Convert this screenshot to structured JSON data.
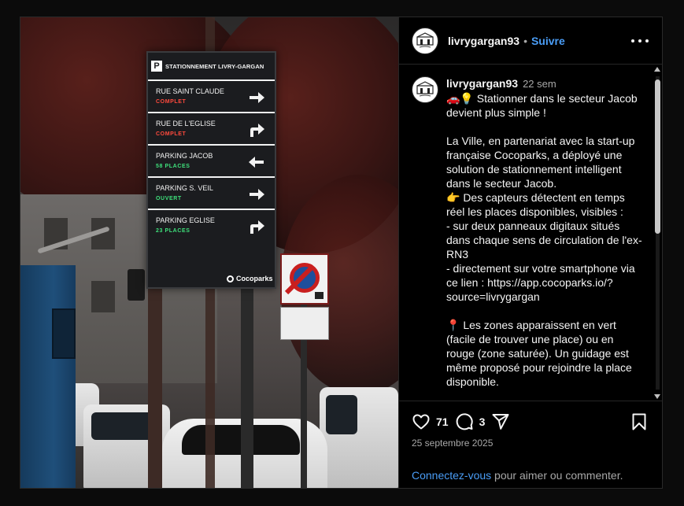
{
  "photo": {
    "sign": {
      "title": "STATIONNEMENT LIVRY-GARGAN",
      "p_letter": "P",
      "rows": [
        {
          "name": "RUE SAINT CLAUDE",
          "status": "COMPLET",
          "status_color": "#ff4a3d",
          "arrow": "right"
        },
        {
          "name": "RUE DE L'EGLISE",
          "status": "COMPLET",
          "status_color": "#ff4a3d",
          "arrow": "up-right"
        },
        {
          "name": "PARKING JACOB",
          "status": "58 PLACES",
          "status_color": "#3ee07b",
          "arrow": "left"
        },
        {
          "name": "PARKING S. VEIL",
          "status": "OUVERT",
          "status_color": "#3ee07b",
          "arrow": "right"
        },
        {
          "name": "PARKING EGLISE",
          "status": "23 PLACES",
          "status_color": "#3ee07b",
          "arrow": "up-right"
        }
      ],
      "brand": "Cocoparks"
    }
  },
  "header": {
    "username": "livrygargan93",
    "separator": "•",
    "follow_label": "Suivre",
    "more_icon": "more-horizontal-icon"
  },
  "post": {
    "username": "livrygargan93",
    "time": "22 sem",
    "caption": "🚗💡 Stationner dans le secteur Jacob devient plus simple !\n\nLa Ville, en partenariat avec la start-up française Cocoparks, a déployé une solution de stationnement intelligent dans le secteur Jacob.\n👉 Des capteurs détectent en temps réel les places disponibles, visibles :\n- sur deux panneaux digitaux situés dans chaque sens de circulation de l'ex-RN3\n- directement sur votre smartphone via ce lien : https://app.cocoparks.io/?source=livrygargan\n\n📍 Les zones apparaissent en vert (facile de trouver une place) ou en rouge (zone saturée). Un guidage est même proposé pour rejoindre la place disponible."
  },
  "actions": {
    "likes": "71",
    "comments": "3",
    "like_icon": "heart-icon",
    "comment_icon": "comment-icon",
    "share_icon": "send-icon",
    "save_icon": "bookmark-icon",
    "date": "25 septembre 2025"
  },
  "login": {
    "link": "Connectez-vous",
    "rest": " pour aimer ou commenter."
  },
  "colors": {
    "accent": "#4a9df6",
    "muted": "#a8a8a8",
    "background": "#000000"
  }
}
